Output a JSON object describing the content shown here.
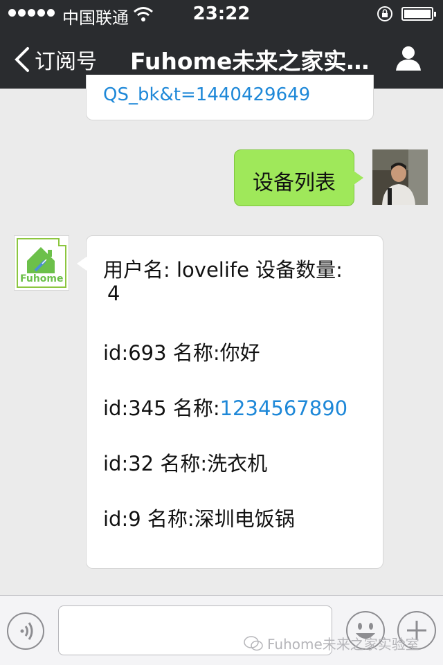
{
  "status_bar": {
    "carrier": "中国联通",
    "time": "23:22"
  },
  "nav": {
    "back_label": "订阅号",
    "title": "Fuhome未来之家实…"
  },
  "messages": {
    "previous_link": "QS_bk&t=1440429649",
    "user_message": "设备列表",
    "device_list": {
      "header": "用户名: lovelife 设备数量:",
      "count": "4",
      "items": [
        {
          "id": "id:693",
          "name_label": "名称:",
          "name": "你好"
        },
        {
          "id": "id:345",
          "name_label": "名称:",
          "name": "1234567890"
        },
        {
          "id": "id:32",
          "name_label": "名称:",
          "name": "洗衣机"
        },
        {
          "id": "id:9",
          "name_label": "名称:",
          "name": "深圳电饭锅"
        }
      ]
    }
  },
  "bot_avatar": {
    "logo_text": "Fuhome"
  },
  "watermark": "Fuhome未来之家实验室",
  "colors": {
    "bar": "#2a2c2f",
    "chat_bg": "#ebebeb",
    "sent_bubble": "#9fe85a",
    "link": "#1e88d8"
  }
}
